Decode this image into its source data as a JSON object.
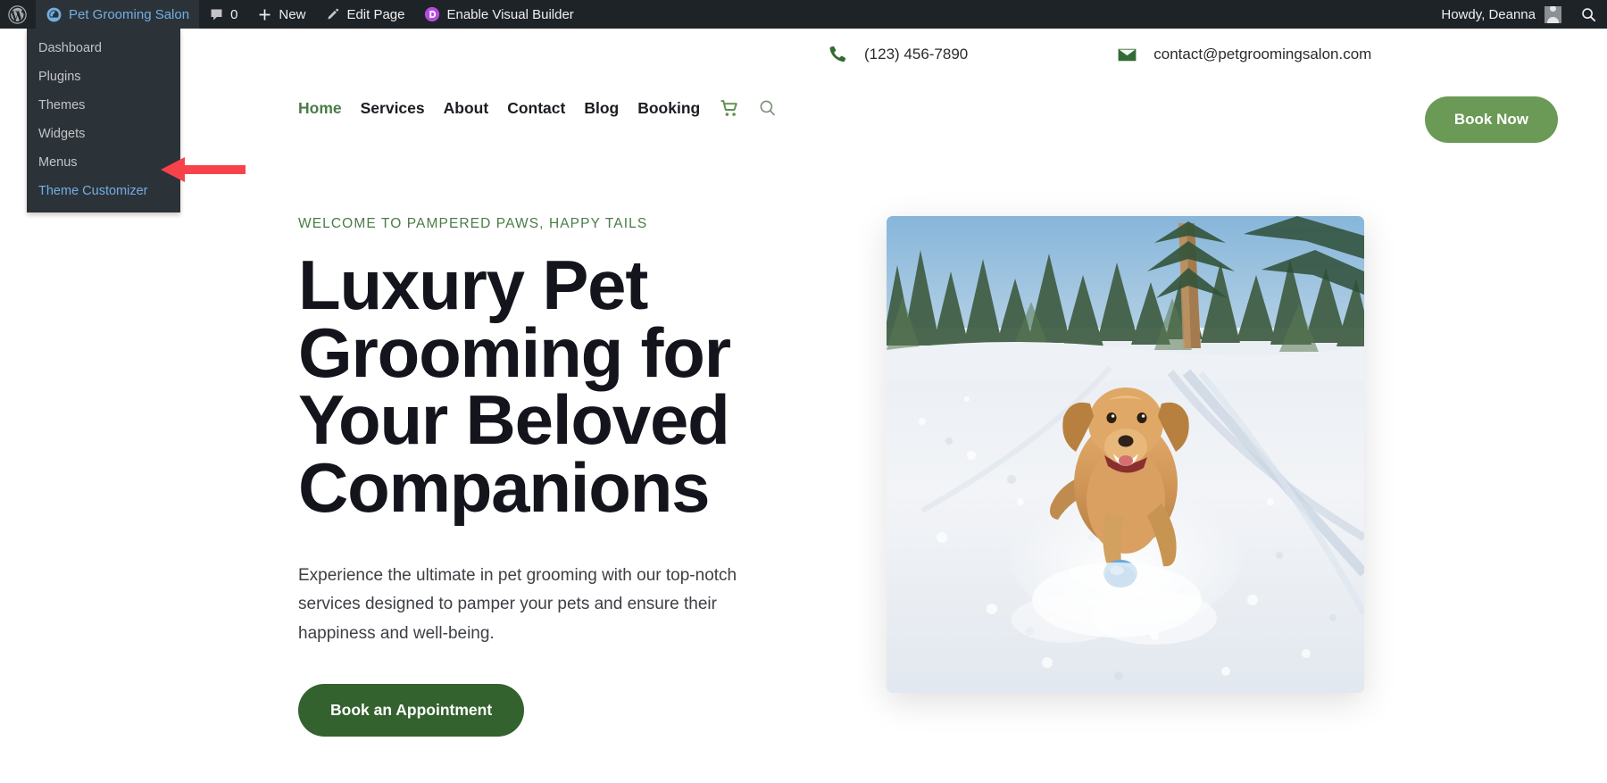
{
  "adminbar": {
    "wp_logo_icon": "wordpress-logo-icon",
    "site_name": "Pet Grooming Salon",
    "site_icon": "dashboard-speedometer-icon",
    "comments_icon": "comment-bubble-icon",
    "comments_count": "0",
    "new_icon": "plus-icon",
    "new_label": "New",
    "edit_icon": "pencil-icon",
    "edit_label": "Edit Page",
    "divi_icon": "divi-d-icon",
    "divi_label": "Enable Visual Builder",
    "howdy": "Howdy, Deanna",
    "avatar_icon": "user-avatar-icon",
    "search_icon": "search-icon"
  },
  "dropdown": {
    "items": [
      {
        "label": "Dashboard",
        "active": false
      },
      {
        "label": "Plugins",
        "active": false
      },
      {
        "label": "Themes",
        "active": false
      },
      {
        "label": "Widgets",
        "active": false
      },
      {
        "label": "Menus",
        "active": false
      },
      {
        "label": "Theme Customizer",
        "active": true
      }
    ]
  },
  "annotation": {
    "arrow_name": "red-pointer-arrow",
    "arrow_color": "#f8424b",
    "points_to": "Theme Customizer"
  },
  "site": {
    "topbar": {
      "phone_icon": "phone-icon",
      "phone": "(123) 456-7890",
      "email_icon": "envelope-icon",
      "email": "contact@petgroomingsalon.com"
    },
    "nav": {
      "items": [
        {
          "label": "Home",
          "active": true
        },
        {
          "label": "Services",
          "active": false
        },
        {
          "label": "About",
          "active": false
        },
        {
          "label": "Contact",
          "active": false
        },
        {
          "label": "Blog",
          "active": false
        },
        {
          "label": "Booking",
          "active": false
        }
      ],
      "cart_icon": "shopping-cart-icon",
      "search_icon": "search-icon",
      "book_now_label": "Book Now"
    },
    "hero": {
      "eyebrow": "WELCOME TO PAMPERED PAWS, HAPPY TAILS",
      "title": "Luxury Pet Grooming for Your Beloved Companions",
      "body": "Experience the ultimate in pet grooming with our top-notch services designed to pamper your pets and ensure their happiness and well-being.",
      "cta_label": "Book an Appointment",
      "image_alt": "golden-retriever-running-in-snow-photo"
    }
  },
  "colors": {
    "admin_bar_bg": "#1d2327",
    "dropdown_bg": "#2c3338",
    "wp_blue": "#72aee6",
    "divi_purple": "#b44ae0",
    "brand_green": "#4a7c46",
    "button_green": "#6a9a55",
    "cta_green": "#34622f",
    "arrow_red": "#f8424b",
    "heading_dark": "#14151c"
  }
}
